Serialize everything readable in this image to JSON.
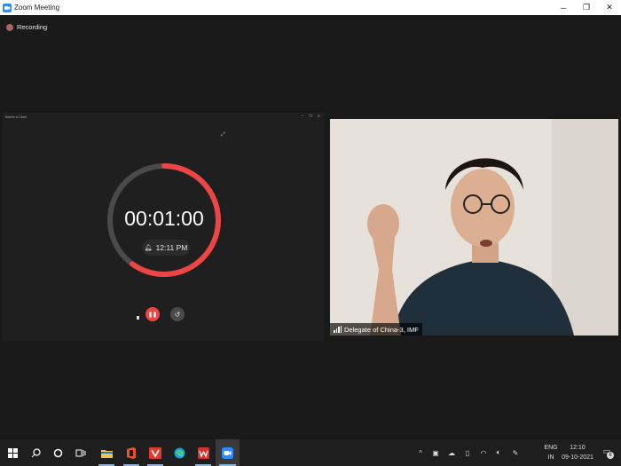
{
  "window": {
    "title": "Zoom Meeting",
    "controls": [
      "─",
      "❐",
      "✕"
    ]
  },
  "recording": {
    "label": "Recording"
  },
  "shared_app": {
    "title": "Alarms & Clock",
    "window_controls": [
      "─",
      "❐",
      "✕"
    ],
    "timer": {
      "display": "00:01:00",
      "alarm_time": "12:11 PM",
      "progress": 0.4
    },
    "colors": {
      "progress": "#ef4444",
      "track": "#4a4a4a"
    }
  },
  "participant": {
    "name": "Delegate of China-3, IMF"
  },
  "taskbar": {
    "language": [
      "ENG",
      "IN"
    ],
    "time": "12:10",
    "date": "09-10-2021",
    "notification_count": "6"
  }
}
